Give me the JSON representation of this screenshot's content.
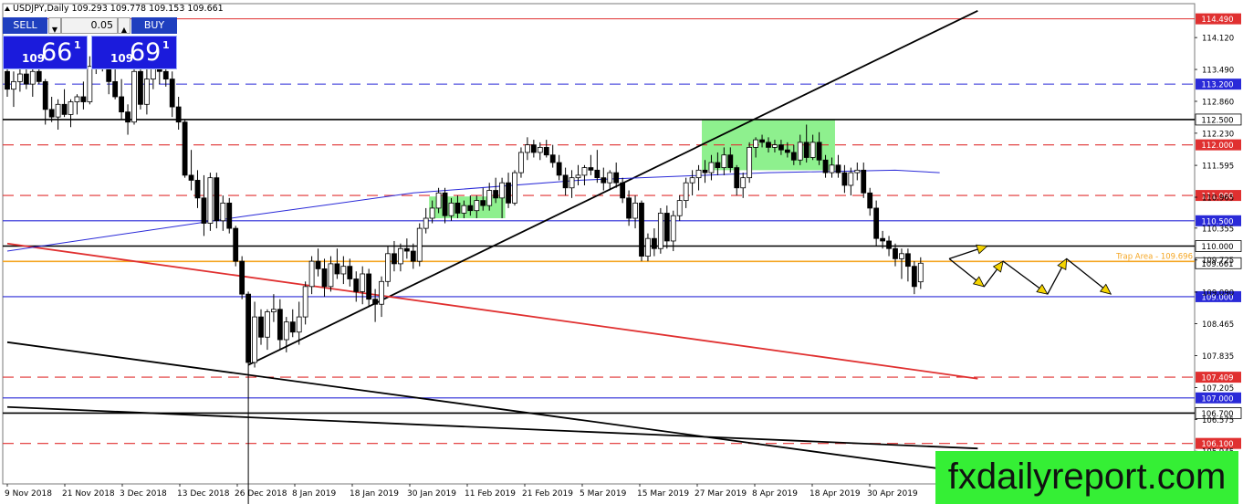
{
  "symbol_header": "USDJPY,Daily  109.293 109.778 109.153 109.661",
  "trade_panel": {
    "sell_label": "SELL",
    "buy_label": "BUY",
    "lot": "0.05",
    "sell_small": "109",
    "sell_big": "66",
    "sell_sup": "1",
    "buy_small": "109",
    "buy_big": "69",
    "buy_sup": "1",
    "colors": {
      "button": "#1f3fbf",
      "price_box": "#1b1bdc"
    }
  },
  "watermark": "fxdailyreport.com",
  "chart_data": {
    "type": "candlestick",
    "symbol": "USDJPY",
    "timeframe": "Daily",
    "ohlc_header": {
      "open": 109.293,
      "high": 109.778,
      "low": 109.153,
      "close": 109.661
    },
    "ylim": [
      105.3,
      114.79
    ],
    "y_ticks": [
      "114.120",
      "113.490",
      "112.860",
      "112.230",
      "111.595",
      "110.965",
      "110.355",
      "109.725",
      "109.090",
      "108.465",
      "107.835",
      "107.205",
      "106.575",
      "105.945"
    ],
    "x_tick_labels": [
      "9 Nov 2018",
      "21 Nov 2018",
      "3 Dec 2018",
      "13 Dec 2018",
      "26 Dec 2018",
      "8 Jan 2019",
      "18 Jan 2019",
      "30 Jan 2019",
      "11 Feb 2019",
      "21 Feb 2019",
      "5 Mar 2019",
      "15 Mar 2019",
      "27 Mar 2019",
      "8 Apr 2019",
      "18 Apr 2019",
      "30 Apr 2019"
    ],
    "candles_ohlc": [
      [
        113.45,
        113.8,
        112.95,
        113.1
      ],
      [
        113.1,
        113.45,
        112.75,
        113.25
      ],
      [
        113.25,
        113.5,
        113.05,
        113.4
      ],
      [
        113.4,
        113.9,
        113.1,
        113.2
      ],
      [
        113.2,
        113.6,
        112.95,
        113.45
      ],
      [
        113.45,
        113.85,
        113.2,
        113.25
      ],
      [
        113.25,
        113.3,
        112.4,
        112.7
      ],
      [
        112.7,
        112.95,
        112.45,
        112.55
      ],
      [
        112.55,
        112.9,
        112.3,
        112.8
      ],
      [
        112.8,
        113.1,
        112.55,
        112.6
      ],
      [
        112.6,
        112.9,
        112.35,
        112.85
      ],
      [
        112.85,
        113.0,
        112.6,
        112.95
      ],
      [
        112.95,
        113.25,
        112.7,
        112.85
      ],
      [
        112.85,
        113.75,
        112.8,
        113.55
      ],
      [
        113.55,
        113.9,
        113.4,
        113.7
      ],
      [
        113.7,
        114.0,
        113.45,
        113.6
      ],
      [
        113.6,
        113.85,
        113.0,
        113.25
      ],
      [
        113.25,
        113.6,
        112.9,
        112.95
      ],
      [
        112.95,
        113.3,
        112.5,
        112.65
      ],
      [
        112.65,
        112.8,
        112.2,
        112.45
      ],
      [
        112.45,
        113.6,
        112.4,
        113.45
      ],
      [
        113.45,
        113.75,
        112.7,
        112.8
      ],
      [
        112.8,
        113.6,
        112.6,
        113.3
      ],
      [
        113.3,
        113.8,
        113.1,
        113.55
      ],
      [
        113.55,
        113.95,
        113.2,
        113.45
      ],
      [
        113.45,
        113.65,
        113.15,
        113.3
      ],
      [
        113.3,
        113.45,
        112.55,
        112.75
      ],
      [
        112.75,
        112.95,
        112.3,
        112.45
      ],
      [
        112.45,
        112.5,
        111.35,
        111.4
      ],
      [
        111.4,
        111.9,
        111.1,
        111.3
      ],
      [
        111.3,
        111.5,
        110.75,
        110.95
      ],
      [
        110.95,
        111.4,
        110.2,
        110.45
      ],
      [
        110.45,
        111.45,
        110.3,
        111.35
      ],
      [
        111.35,
        111.45,
        110.35,
        110.5
      ],
      [
        110.5,
        111.0,
        110.3,
        110.85
      ],
      [
        110.85,
        110.95,
        110.25,
        110.35
      ],
      [
        110.35,
        110.4,
        109.6,
        109.7
      ],
      [
        109.7,
        109.8,
        108.95,
        109.05
      ],
      [
        109.05,
        109.1,
        104.9,
        107.7
      ],
      [
        107.7,
        108.9,
        107.6,
        108.6
      ],
      [
        108.6,
        108.75,
        108.05,
        108.2
      ],
      [
        108.2,
        108.75,
        107.95,
        108.7
      ],
      [
        108.7,
        109.05,
        108.5,
        108.75
      ],
      [
        108.75,
        108.95,
        107.95,
        108.15
      ],
      [
        108.15,
        108.6,
        107.9,
        108.5
      ],
      [
        108.5,
        108.75,
        108.2,
        108.3
      ],
      [
        108.3,
        108.9,
        108.05,
        108.6
      ],
      [
        108.6,
        109.3,
        108.45,
        109.2
      ],
      [
        109.2,
        109.8,
        109.05,
        109.7
      ],
      [
        109.7,
        109.95,
        109.4,
        109.55
      ],
      [
        109.55,
        109.75,
        109.0,
        109.2
      ],
      [
        109.2,
        109.8,
        109.1,
        109.65
      ],
      [
        109.65,
        109.95,
        109.35,
        109.45
      ],
      [
        109.45,
        109.8,
        109.25,
        109.6
      ],
      [
        109.6,
        109.75,
        109.2,
        109.35
      ],
      [
        109.35,
        109.5,
        108.9,
        109.1
      ],
      [
        109.1,
        109.6,
        108.85,
        109.45
      ],
      [
        109.45,
        109.55,
        108.8,
        108.95
      ],
      [
        108.95,
        109.15,
        108.5,
        108.85
      ],
      [
        108.85,
        109.4,
        108.6,
        109.3
      ],
      [
        109.3,
        110.0,
        109.2,
        109.85
      ],
      [
        109.85,
        110.1,
        109.5,
        109.65
      ],
      [
        109.65,
        110.05,
        109.5,
        109.95
      ],
      [
        109.95,
        110.15,
        109.75,
        109.9
      ],
      [
        109.9,
        110.05,
        109.55,
        109.7
      ],
      [
        109.7,
        110.45,
        109.6,
        110.35
      ],
      [
        110.35,
        110.75,
        110.25,
        110.55
      ],
      [
        110.55,
        110.9,
        110.45,
        110.75
      ],
      [
        110.75,
        111.15,
        110.65,
        111.05
      ],
      [
        111.05,
        111.15,
        110.45,
        110.6
      ],
      [
        110.6,
        110.95,
        110.5,
        110.85
      ],
      [
        110.85,
        111.0,
        110.55,
        110.65
      ],
      [
        110.65,
        110.9,
        110.55,
        110.8
      ],
      [
        110.8,
        111.0,
        110.6,
        110.7
      ],
      [
        110.7,
        111.0,
        110.55,
        110.9
      ],
      [
        110.9,
        111.15,
        110.7,
        110.8
      ],
      [
        110.8,
        111.25,
        110.7,
        111.1
      ],
      [
        111.1,
        111.35,
        110.85,
        110.95
      ],
      [
        110.95,
        111.35,
        110.55,
        111.25
      ],
      [
        111.25,
        111.45,
        110.75,
        110.85
      ],
      [
        110.85,
        111.5,
        110.8,
        111.45
      ],
      [
        111.45,
        111.95,
        111.35,
        111.85
      ],
      [
        111.85,
        112.15,
        111.7,
        112.0
      ],
      [
        112.0,
        112.1,
        111.75,
        111.85
      ],
      [
        111.85,
        112.05,
        111.7,
        111.95
      ],
      [
        111.95,
        112.1,
        111.75,
        111.8
      ],
      [
        111.8,
        112.0,
        111.55,
        111.65
      ],
      [
        111.65,
        111.8,
        111.3,
        111.4
      ],
      [
        111.4,
        111.55,
        111.0,
        111.15
      ],
      [
        111.15,
        111.5,
        110.95,
        111.35
      ],
      [
        111.35,
        111.6,
        111.2,
        111.4
      ],
      [
        111.4,
        111.6,
        111.2,
        111.55
      ],
      [
        111.55,
        111.8,
        111.4,
        111.5
      ],
      [
        111.5,
        111.9,
        111.25,
        111.35
      ],
      [
        111.35,
        111.55,
        111.1,
        111.25
      ],
      [
        111.25,
        111.5,
        111.1,
        111.45
      ],
      [
        111.45,
        111.65,
        111.15,
        111.25
      ],
      [
        111.25,
        111.35,
        110.85,
        110.95
      ],
      [
        110.95,
        111.1,
        110.4,
        110.55
      ],
      [
        110.55,
        111.0,
        110.35,
        110.85
      ],
      [
        110.85,
        110.9,
        109.7,
        109.8
      ],
      [
        109.8,
        110.25,
        109.7,
        110.15
      ],
      [
        110.15,
        110.35,
        109.8,
        109.95
      ],
      [
        109.95,
        110.75,
        109.85,
        110.65
      ],
      [
        110.65,
        110.8,
        109.95,
        110.1
      ],
      [
        110.1,
        110.7,
        109.9,
        110.6
      ],
      [
        110.6,
        111.0,
        110.5,
        110.9
      ],
      [
        110.9,
        111.35,
        110.75,
        111.25
      ],
      [
        111.25,
        111.5,
        111.0,
        111.35
      ],
      [
        111.35,
        111.6,
        111.1,
        111.5
      ],
      [
        111.5,
        111.7,
        111.25,
        111.45
      ],
      [
        111.45,
        111.8,
        111.3,
        111.65
      ],
      [
        111.65,
        111.85,
        111.4,
        111.55
      ],
      [
        111.55,
        111.95,
        111.4,
        111.8
      ],
      [
        111.8,
        111.95,
        111.45,
        111.55
      ],
      [
        111.55,
        111.6,
        111.0,
        111.15
      ],
      [
        111.15,
        111.45,
        110.95,
        111.35
      ],
      [
        111.35,
        112.05,
        111.25,
        111.95
      ],
      [
        111.95,
        112.15,
        111.75,
        112.1
      ],
      [
        112.1,
        112.2,
        111.95,
        112.05
      ],
      [
        112.05,
        112.15,
        111.85,
        111.95
      ],
      [
        111.95,
        112.1,
        111.85,
        112.0
      ],
      [
        112.0,
        112.1,
        111.8,
        111.9
      ],
      [
        111.9,
        112.05,
        111.75,
        111.85
      ],
      [
        111.85,
        112.0,
        111.6,
        111.7
      ],
      [
        111.7,
        112.2,
        111.6,
        112.05
      ],
      [
        112.05,
        112.4,
        111.65,
        111.75
      ],
      [
        111.75,
        112.2,
        111.7,
        112.05
      ],
      [
        112.05,
        112.25,
        111.6,
        111.7
      ],
      [
        111.7,
        111.8,
        111.35,
        111.45
      ],
      [
        111.45,
        111.75,
        111.35,
        111.6
      ],
      [
        111.6,
        111.8,
        111.35,
        111.45
      ],
      [
        111.45,
        111.6,
        111.05,
        111.2
      ],
      [
        111.2,
        111.55,
        111.0,
        111.45
      ],
      [
        111.45,
        111.65,
        111.3,
        111.5
      ],
      [
        111.5,
        111.65,
        110.95,
        111.05
      ],
      [
        111.05,
        111.15,
        110.6,
        110.75
      ],
      [
        110.75,
        110.9,
        110.0,
        110.15
      ],
      [
        110.15,
        110.3,
        109.95,
        110.1
      ],
      [
        110.1,
        110.2,
        109.8,
        109.95
      ],
      [
        109.95,
        110.05,
        109.6,
        109.75
      ],
      [
        109.75,
        109.95,
        109.35,
        109.85
      ],
      [
        109.85,
        109.95,
        109.3,
        109.6
      ],
      [
        109.6,
        109.7,
        109.05,
        109.2
      ],
      [
        109.293,
        109.778,
        109.153,
        109.661
      ]
    ],
    "moving_average": [
      [
        0,
        109.9
      ],
      [
        38,
        110.6
      ],
      [
        64,
        111.05
      ],
      [
        90,
        111.3
      ],
      [
        120,
        111.45
      ],
      [
        140,
        111.5
      ],
      [
        147,
        111.45
      ]
    ],
    "horizontal_levels": [
      {
        "price": 114.49,
        "label": "114.490",
        "color": "#e03030",
        "style": "solid"
      },
      {
        "price": 113.2,
        "label": "113.200",
        "color": "#2a2ad8",
        "style": "dashed"
      },
      {
        "price": 112.5,
        "label": "112.500",
        "color": "#000000",
        "style": "solid"
      },
      {
        "price": 112.0,
        "label": "112.000",
        "color": "#e03030",
        "style": "dashed"
      },
      {
        "price": 111.0,
        "label": "111.000",
        "color": "#e03030",
        "style": "dashed"
      },
      {
        "price": 110.5,
        "label": "110.500",
        "color": "#2a2ad8",
        "style": "solid"
      },
      {
        "price": 110.0,
        "label": "110.000",
        "color": "#000000",
        "style": "solid"
      },
      {
        "price": 109.661,
        "label": "109.661",
        "color": "#000000",
        "style": "none"
      },
      {
        "price": 109.0,
        "label": "109.000",
        "color": "#2a2ad8",
        "style": "solid"
      },
      {
        "price": 107.409,
        "label": "107.409",
        "color": "#e03030",
        "style": "dashed"
      },
      {
        "price": 107.0,
        "label": "107.000",
        "color": "#2a2ad8",
        "style": "solid"
      },
      {
        "price": 106.7,
        "label": "106.700",
        "color": "#000000",
        "style": "solid"
      },
      {
        "price": 106.1,
        "label": "106.100",
        "color": "#e03030",
        "style": "dashed"
      }
    ],
    "trap_area": {
      "price": 109.696,
      "label": "Trap Area - 109.696",
      "color": "#f5a623"
    },
    "trend_lines": [
      {
        "from": [
          38,
          107.65
        ],
        "to": [
          153,
          114.65
        ],
        "color": "#000000"
      },
      {
        "from": [
          0,
          110.05
        ],
        "to": [
          153,
          107.38
        ],
        "color": "#e03030"
      },
      {
        "from": [
          0,
          108.1
        ],
        "to": [
          153,
          105.5
        ],
        "color": "#000000"
      },
      {
        "from": [
          0,
          106.82
        ],
        "to": [
          153,
          106.0
        ],
        "color": "#000000"
      }
    ],
    "zones": [
      {
        "x_range": [
          66.5,
          78.5
        ],
        "price_range": [
          110.55,
          110.98
        ],
        "color": "#8ef08e"
      },
      {
        "x_range": [
          109.5,
          130.5
        ],
        "price_range": [
          111.5,
          112.5
        ],
        "color": "#8ef08e"
      }
    ],
    "projection_path": [
      [
        148.5,
        109.75
      ],
      [
        154.5,
        110.0
      ],
      [
        148.5,
        109.75
      ],
      [
        154,
        109.2
      ],
      [
        157,
        109.7
      ],
      [
        164,
        109.05
      ],
      [
        167,
        109.75
      ],
      [
        174,
        109.05
      ]
    ],
    "grid": false,
    "colors": {
      "bull": "#ffffff",
      "bear": "#000000",
      "ma": "#2a2ad8",
      "arrow": "#f5d400"
    }
  }
}
